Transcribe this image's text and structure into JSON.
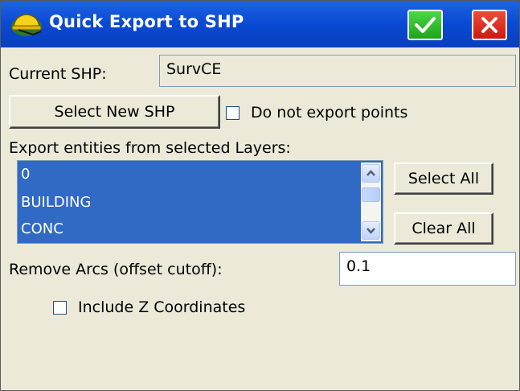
{
  "window": {
    "title": "Quick Export to SHP",
    "ok_icon": "checkmark-icon",
    "close_icon": "close-icon",
    "app_icon": "surveyor-helmet-icon"
  },
  "form": {
    "current_shp_label": "Current SHP:",
    "current_shp_value": "SurvCE",
    "select_new_shp_label": "Select New SHP",
    "do_not_export_points_label": "Do not export points",
    "do_not_export_points_checked": false,
    "layers_label": "Export entities from selected Layers:",
    "layers": [
      "0",
      "BUILDING",
      "CONC"
    ],
    "select_all_label": "Select All",
    "clear_all_label": "Clear All",
    "remove_arcs_label": "Remove Arcs (offset cutoff):",
    "remove_arcs_value": "0.1",
    "include_z_label": "Include Z Coordinates",
    "include_z_checked": false
  },
  "colors": {
    "titlebar": "#0a49d2",
    "ok_button": "#1da51a",
    "close_button": "#cc1a10",
    "list_selection": "#316ac5",
    "dialog_background": "#ece9d8"
  }
}
